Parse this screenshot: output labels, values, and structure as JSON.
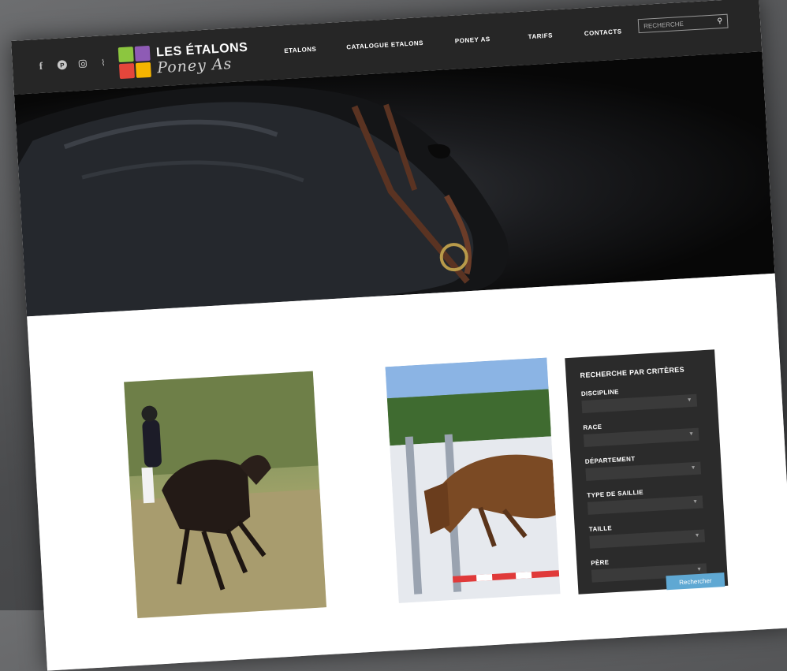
{
  "header": {
    "logo": {
      "line1": "LES ÉTALONS",
      "line2": "Poney As",
      "colors": [
        "#8cc63f",
        "#8e5bb5",
        "#e5463b",
        "#f5b400"
      ]
    },
    "social": [
      {
        "name": "facebook-icon",
        "glyph": "f"
      },
      {
        "name": "pinterest-icon",
        "glyph": "P"
      },
      {
        "name": "instagram-icon",
        "glyph": ""
      },
      {
        "name": "rss-icon",
        "glyph": "⌇"
      }
    ],
    "nav": [
      "ETALONS",
      "CATALOGUE ETALONS",
      "PONEY AS",
      "TARIFS",
      "CONTACTS"
    ],
    "search": {
      "placeholder": "RECHERCHE",
      "icon": "search-icon"
    }
  },
  "sidebar": {
    "title": "RECHERCHE PAR CRITÈRES",
    "fields": [
      "DISCIPLINE",
      "RACE",
      "DÉPARTEMENT",
      "TYPE DE SAILLIE",
      "TAILLE",
      "PÈRE"
    ],
    "submit_label": "Rechercher"
  },
  "colors": {
    "header_bg": "#262626",
    "sidebar_bg": "#2b2b2b",
    "accent": "#5fa8d3"
  }
}
